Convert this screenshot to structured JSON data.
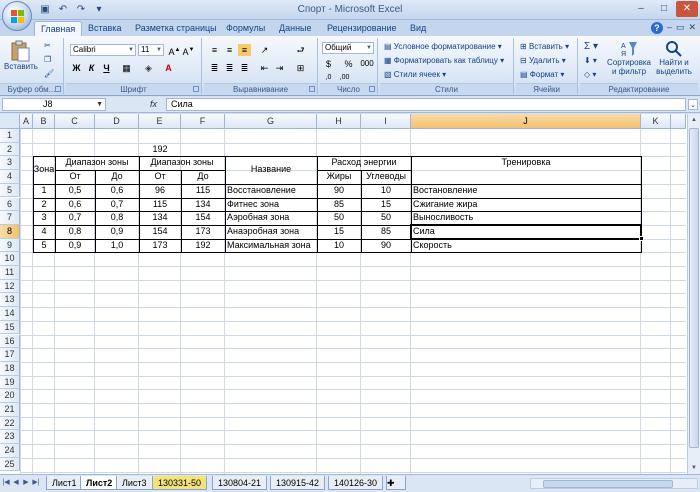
{
  "window": {
    "title": "Спорт - Microsoft Excel"
  },
  "tabs": [
    "Главная",
    "Вставка",
    "Разметка страницы",
    "Формулы",
    "Данные",
    "Рецензирование",
    "Вид"
  ],
  "ribbon": {
    "clipboard": {
      "paste": "Вставить",
      "label": "Буфер обм..."
    },
    "font": {
      "name": "Calibri",
      "size": "11",
      "label": "Шрифт",
      "bold": "Ж",
      "italic": "К",
      "underline": "Ч"
    },
    "alignment": {
      "label": "Выравнивание"
    },
    "number": {
      "format": "Общий",
      "percent": "%",
      "thousands": "000",
      "label": "Число"
    },
    "styles": {
      "conditional": "Условное форматирование",
      "as_table": "Форматировать как таблицу",
      "cell_styles": "Стили ячеек",
      "label": "Стили"
    },
    "cells": {
      "insert": "Вставить",
      "delete": "Удалить",
      "format": "Формат",
      "label": "Ячейки"
    },
    "editing": {
      "sigma": "Σ",
      "sort": "Сортировка\nи фильтр",
      "find": "Найти и\nвыделить",
      "label": "Редактирование"
    }
  },
  "formula_bar": {
    "cell_ref": "J8",
    "fx": "fx",
    "content": "Сила"
  },
  "columns": [
    "A",
    "B",
    "C",
    "D",
    "E",
    "F",
    "G",
    "H",
    "I",
    "J",
    "K"
  ],
  "rows": [
    "1",
    "2",
    "3",
    "4",
    "5",
    "6",
    "7",
    "8",
    "9",
    "10",
    "11",
    "12",
    "13",
    "14",
    "15",
    "16",
    "17",
    "18",
    "19",
    "20",
    "21",
    "22",
    "23",
    "24",
    "25"
  ],
  "sheet": {
    "e2": "192",
    "h_zone": "Зона",
    "h_range1": "Диапазон зоны",
    "h_range2": "Диапазон зоны",
    "h_name": "Название",
    "h_energy": "Расход энергии",
    "h_training": "Тренировка",
    "h_from1": "От",
    "h_to1": "До",
    "h_from2": "От",
    "h_to2": "До",
    "h_fat": "Жиры",
    "h_carb": "Углеводы",
    "rows": [
      {
        "zone": "1",
        "c": "0,5",
        "d": "0,6",
        "e": "96",
        "f": "115",
        "name": "Восстановление",
        "fat": "90",
        "carb": "10",
        "training": "Востановление"
      },
      {
        "zone": "2",
        "c": "0,6",
        "d": "0,7",
        "e": "115",
        "f": "134",
        "name": "Фитнес зона",
        "fat": "85",
        "carb": "15",
        "training": "Сжигание жира"
      },
      {
        "zone": "3",
        "c": "0,7",
        "d": "0,8",
        "e": "134",
        "f": "154",
        "name": "Аэробная зона",
        "fat": "50",
        "carb": "50",
        "training": "Выносливость"
      },
      {
        "zone": "4",
        "c": "0,8",
        "d": "0,9",
        "e": "154",
        "f": "173",
        "name": "Анаэробная зона",
        "fat": "15",
        "carb": "85",
        "training": "Сила"
      },
      {
        "zone": "5",
        "c": "0,9",
        "d": "1,0",
        "e": "173",
        "f": "192",
        "name": "Максимальная зона",
        "fat": "10",
        "carb": "90",
        "training": "Скорость"
      }
    ]
  },
  "sheet_tabs": [
    "Лист1",
    "Лист2",
    "Лист3",
    "130331-50",
    "130804-21",
    "130915-42",
    "140126-30"
  ],
  "active_sheet": "Лист2"
}
